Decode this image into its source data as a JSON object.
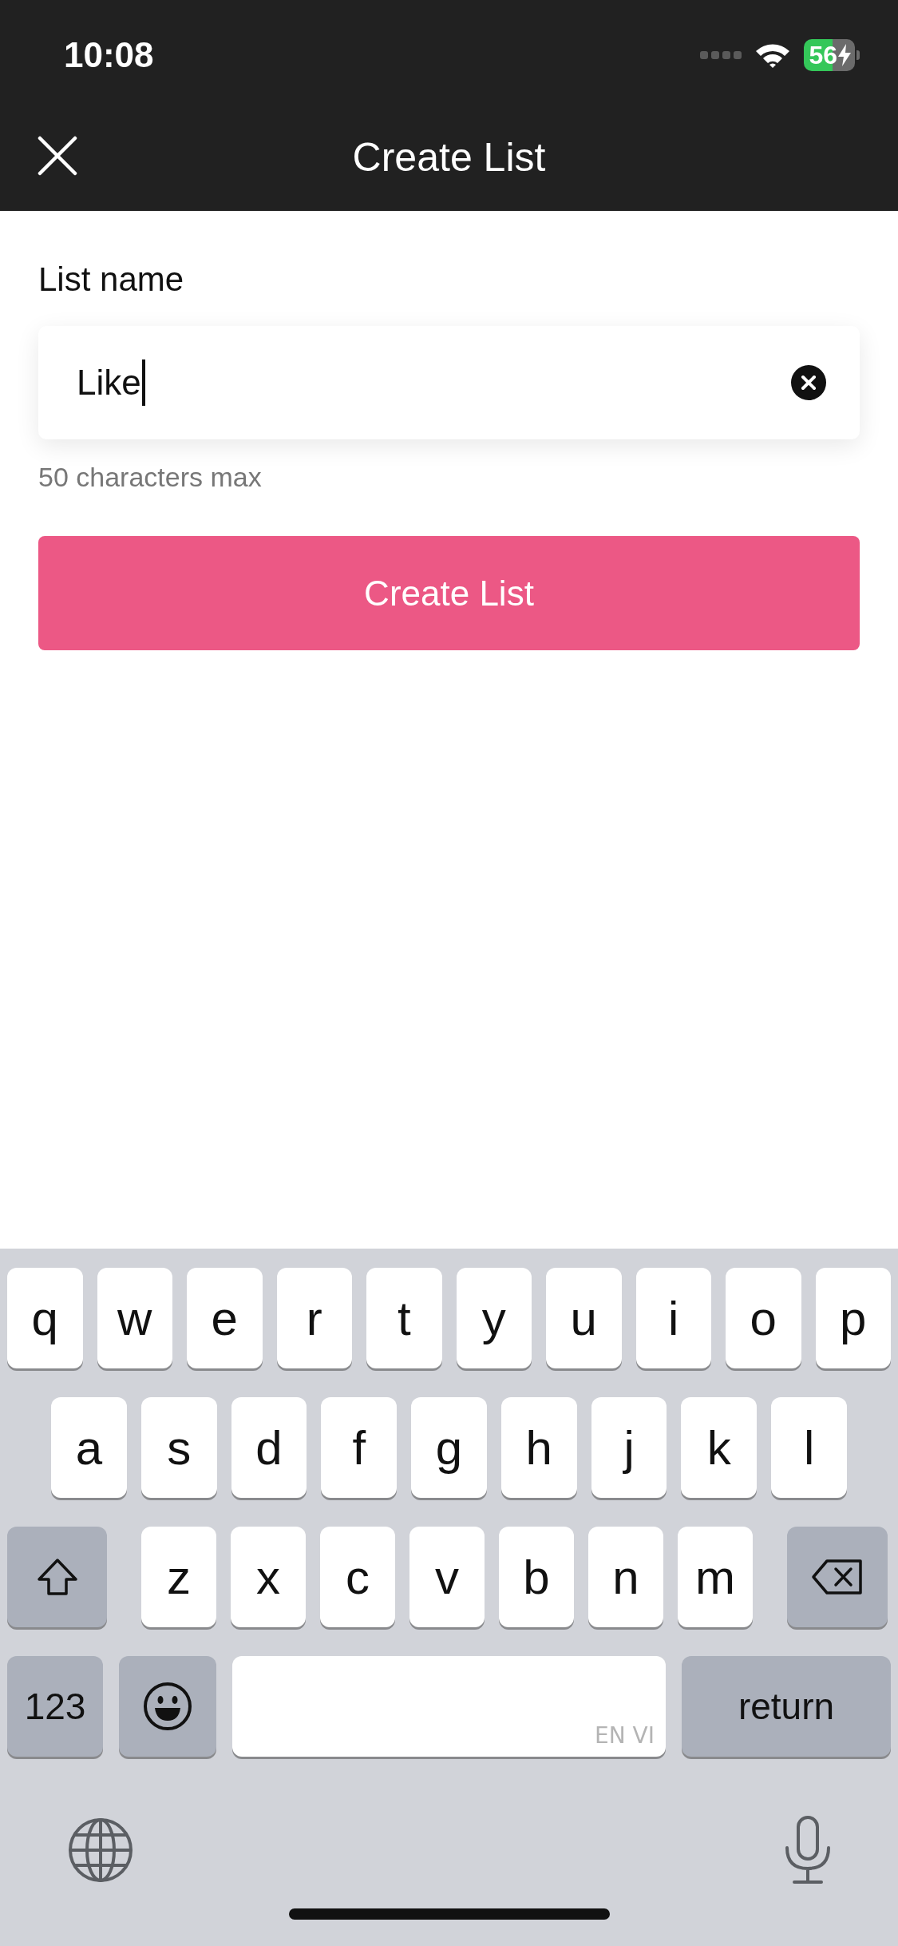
{
  "status_bar": {
    "time": "10:08",
    "battery": "56",
    "charging": true
  },
  "nav": {
    "title": "Create List"
  },
  "form": {
    "label": "List name",
    "field": {
      "value": "Like",
      "focused": true
    },
    "hint": "50 characters max",
    "button": "Create List"
  },
  "keyboard": {
    "rows": [
      [
        {
          "kind": "letter",
          "label": "q"
        },
        {
          "kind": "letter",
          "label": "w"
        },
        {
          "kind": "letter",
          "label": "e"
        },
        {
          "kind": "letter",
          "label": "r"
        },
        {
          "kind": "letter",
          "label": "t"
        },
        {
          "kind": "letter",
          "label": "y"
        },
        {
          "kind": "letter",
          "label": "u"
        },
        {
          "kind": "letter",
          "label": "i"
        },
        {
          "kind": "letter",
          "label": "o"
        },
        {
          "kind": "letter",
          "label": "p"
        }
      ],
      [
        {
          "kind": "letter",
          "label": "a"
        },
        {
          "kind": "letter",
          "label": "s"
        },
        {
          "kind": "letter",
          "label": "d"
        },
        {
          "kind": "letter",
          "label": "f"
        },
        {
          "kind": "letter",
          "label": "g"
        },
        {
          "kind": "letter",
          "label": "h"
        },
        {
          "kind": "letter",
          "label": "j"
        },
        {
          "kind": "letter",
          "label": "k"
        },
        {
          "kind": "letter",
          "label": "l"
        }
      ],
      [
        {
          "kind": "shift"
        },
        {
          "kind": "letter",
          "label": "z"
        },
        {
          "kind": "letter",
          "label": "x"
        },
        {
          "kind": "letter",
          "label": "c"
        },
        {
          "kind": "letter",
          "label": "v"
        },
        {
          "kind": "letter",
          "label": "b"
        },
        {
          "kind": "letter",
          "label": "n"
        },
        {
          "kind": "letter",
          "label": "m"
        },
        {
          "kind": "delete"
        }
      ]
    ],
    "bottom_keys": [
      {
        "kind": "numbers",
        "label": "123"
      },
      {
        "kind": "emoji"
      },
      {
        "kind": "space",
        "label": "EN VI"
      },
      {
        "kind": "return",
        "label": "return"
      }
    ]
  }
}
